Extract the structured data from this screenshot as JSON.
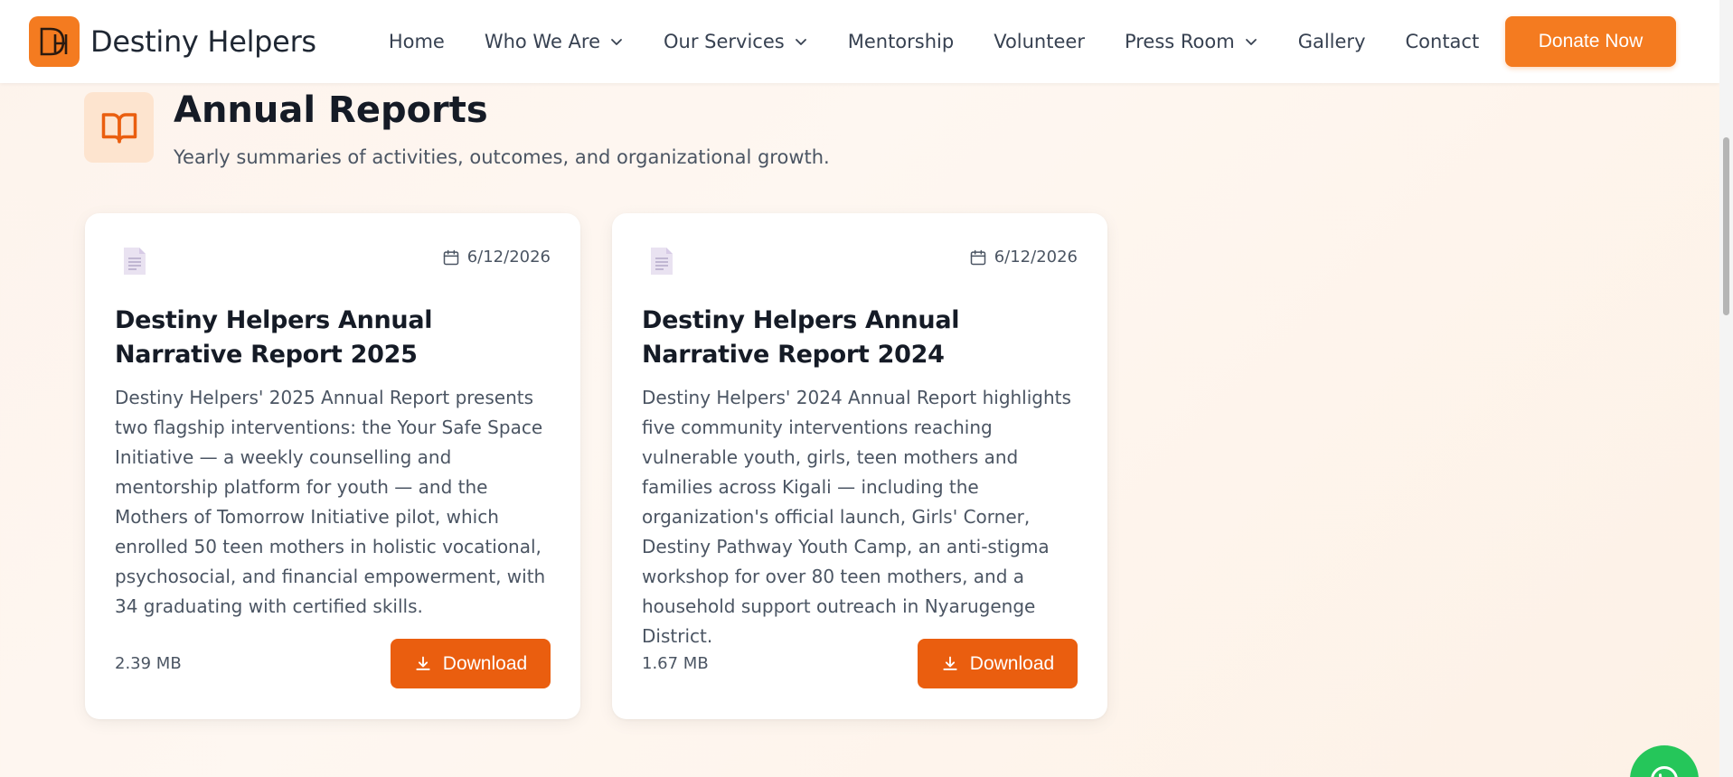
{
  "header": {
    "brand_name": "Destiny Helpers",
    "nav": [
      {
        "label": "Home",
        "has_dropdown": false
      },
      {
        "label": "Who We Are",
        "has_dropdown": true
      },
      {
        "label": "Our Services",
        "has_dropdown": true
      },
      {
        "label": "Mentorship",
        "has_dropdown": false
      },
      {
        "label": "Volunteer",
        "has_dropdown": false
      },
      {
        "label": "Press Room",
        "has_dropdown": true
      },
      {
        "label": "Gallery",
        "has_dropdown": false
      },
      {
        "label": "Contact",
        "has_dropdown": false
      }
    ],
    "donate_label": "Donate Now"
  },
  "section": {
    "icon": "open-book-icon",
    "title": "Annual Reports",
    "subtitle": "Yearly summaries of activities, outcomes, and organizational growth."
  },
  "reports": [
    {
      "icon": "document-icon",
      "date": "6/12/2026",
      "title": "Destiny Helpers Annual Narrative Report 2025",
      "description": "Destiny Helpers' 2025 Annual Report presents two flagship interventions: the Your Safe Space Initiative — a weekly counselling and mentorship platform for youth — and the Mothers of Tomorrow Initiative pilot, which enrolled 50 teen mothers in holistic vocational, psychosocial, and financial empowerment, with 34 graduating with certified skills.",
      "file_size": "2.39 MB",
      "download_label": "Download"
    },
    {
      "icon": "document-icon",
      "date": "6/12/2026",
      "title": "Destiny Helpers Annual Narrative Report 2024",
      "description": "Destiny Helpers' 2024 Annual Report highlights five community interventions reaching vulnerable youth, girls, teen mothers and families across Kigali — including the organization's official launch, Girls' Corner, Destiny Pathway Youth Camp, an anti-stigma workshop for over 80 teen mothers, and a household support outreach in Nyarugenge District.",
      "file_size": "1.67 MB",
      "download_label": "Download"
    }
  ],
  "colors": {
    "brand_orange": "#f47b20",
    "button_orange": "#ea5e0f",
    "chat_green": "#25c65a"
  }
}
